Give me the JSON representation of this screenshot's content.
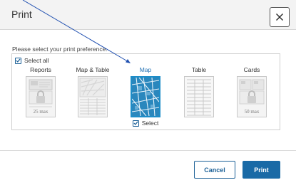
{
  "dialog": {
    "title": "Print",
    "close_label": "✕",
    "instruction": "Please select your print preference.",
    "select_all_label": "Select all"
  },
  "options": [
    {
      "label": "Reports",
      "caption": "25 max",
      "selected": false
    },
    {
      "label": "Map & Table",
      "caption": "",
      "selected": false
    },
    {
      "label": "Map",
      "caption": "",
      "selected": true,
      "select_label": "Select"
    },
    {
      "label": "Table",
      "caption": "",
      "selected": false
    },
    {
      "label": "Cards",
      "caption": "50 max",
      "selected": false
    }
  ],
  "footer": {
    "cancel_label": "Cancel",
    "print_label": "Print"
  },
  "colors": {
    "accent": "#1a6aa6",
    "selected_thumb": "#2a87bd",
    "pointer_line": "#1f4fb0"
  }
}
